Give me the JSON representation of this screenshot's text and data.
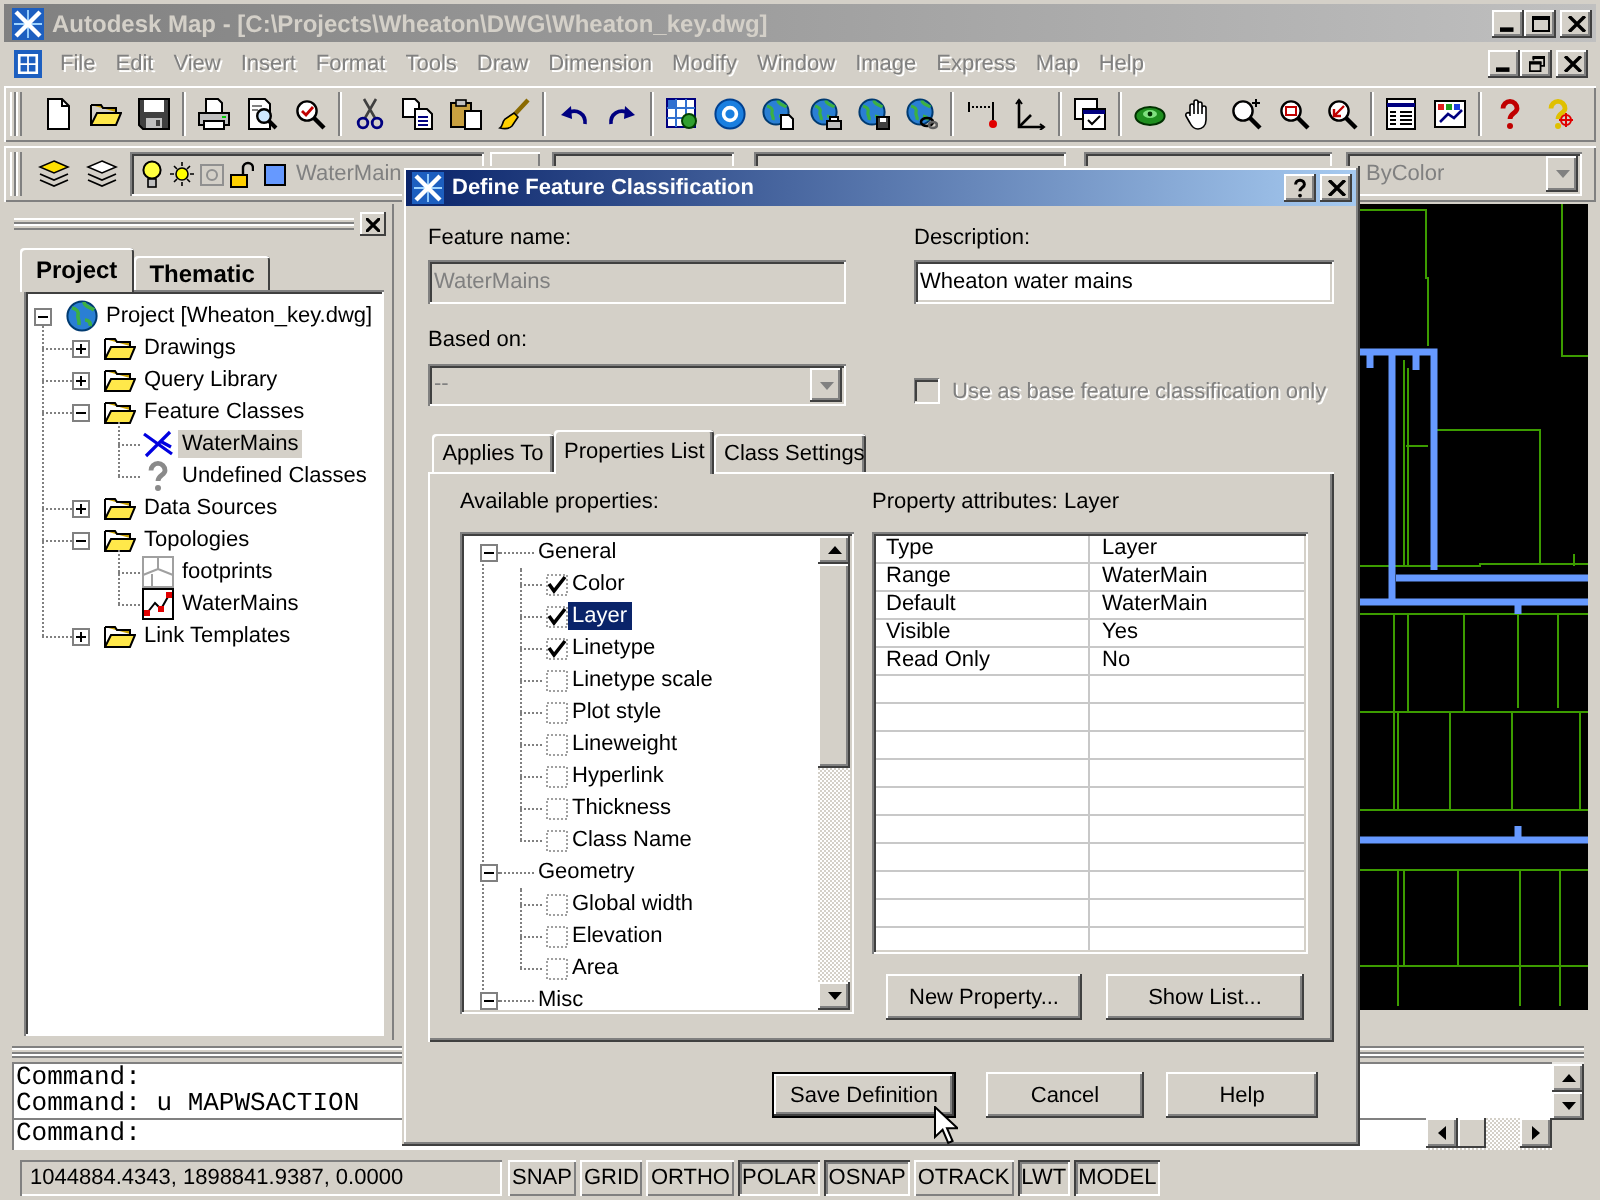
{
  "window": {
    "title": "Autodesk Map - [C:\\Projects\\Wheaton\\DWG\\Wheaton_key.dwg]",
    "active": false
  },
  "menu": [
    {
      "label": "File",
      "disabled": true
    },
    {
      "label": "Edit",
      "disabled": true
    },
    {
      "label": "View",
      "disabled": true
    },
    {
      "label": "Insert",
      "disabled": true
    },
    {
      "label": "Format",
      "disabled": true
    },
    {
      "label": "Tools",
      "disabled": true
    },
    {
      "label": "Draw",
      "disabled": true
    },
    {
      "label": "Dimension",
      "disabled": true
    },
    {
      "label": "Modify",
      "disabled": true
    },
    {
      "label": "Window",
      "disabled": true
    },
    {
      "label": "Image",
      "disabled": true
    },
    {
      "label": "Express",
      "disabled": true
    },
    {
      "label": "Map",
      "disabled": true
    },
    {
      "label": "Help",
      "disabled": true
    }
  ],
  "layer_toolbar": {
    "layer_dropdown": {
      "value": "WaterMain",
      "disabled": true
    },
    "right_dropdown": {
      "value": "ByColor",
      "disabled": true
    }
  },
  "panel": {
    "tabs": [
      {
        "label": "Project",
        "selected": true
      },
      {
        "label": "Thematic",
        "selected": false
      }
    ],
    "tree": [
      {
        "label": "Project [Wheaton_key.dwg]",
        "kind": "project",
        "expanded": true,
        "selected": false,
        "children": [
          {
            "label": "Drawings",
            "kind": "folder",
            "expanded": false,
            "selected": false
          },
          {
            "label": "Query Library",
            "kind": "folder",
            "expanded": false,
            "selected": false
          },
          {
            "label": "Feature Classes",
            "kind": "folder",
            "expanded": true,
            "selected": false,
            "children": [
              {
                "label": "WaterMains",
                "kind": "feature-class",
                "selected": true
              },
              {
                "label": "Undefined Classes",
                "kind": "undefined-class",
                "selected": false
              }
            ]
          },
          {
            "label": "Data Sources",
            "kind": "folder",
            "expanded": false,
            "selected": false
          },
          {
            "label": "Topologies",
            "kind": "folder",
            "expanded": true,
            "selected": false,
            "children": [
              {
                "label": "footprints",
                "kind": "polygon-topology",
                "selected": false
              },
              {
                "label": "WaterMains",
                "kind": "network-topology",
                "selected": false
              }
            ]
          },
          {
            "label": "Link Templates",
            "kind": "folder",
            "expanded": false,
            "selected": false
          }
        ]
      }
    ]
  },
  "dialog": {
    "title": "Define Feature Classification",
    "feature_name": {
      "label": "Feature name:",
      "value": "WaterMains",
      "disabled": true
    },
    "description": {
      "label": "Description:",
      "value": "Wheaton water mains"
    },
    "based_on": {
      "label": "Based on:",
      "value": "--",
      "disabled": true
    },
    "base_only": {
      "label": "Use as base feature classification only",
      "checked": false,
      "disabled": true
    },
    "tabs": [
      {
        "label": "Applies To",
        "selected": false
      },
      {
        "label": "Properties List",
        "selected": true
      },
      {
        "label": "Class Settings",
        "selected": false
      }
    ],
    "available_label": "Available properties:",
    "properties": [
      {
        "label": "General",
        "expanded": true,
        "selected": false,
        "children": [
          {
            "label": "Color",
            "checked": true,
            "selected": false
          },
          {
            "label": "Layer",
            "checked": true,
            "selected": true
          },
          {
            "label": "Linetype",
            "checked": true,
            "selected": false
          },
          {
            "label": "Linetype scale",
            "checked": false,
            "selected": false
          },
          {
            "label": "Plot style",
            "checked": false,
            "selected": false
          },
          {
            "label": "Lineweight",
            "checked": false,
            "selected": false
          },
          {
            "label": "Hyperlink",
            "checked": false,
            "selected": false
          },
          {
            "label": "Thickness",
            "checked": false,
            "selected": false
          },
          {
            "label": "Class Name",
            "checked": false,
            "selected": false
          }
        ]
      },
      {
        "label": "Geometry",
        "expanded": true,
        "selected": false,
        "children": [
          {
            "label": "Global width",
            "checked": false,
            "selected": false
          },
          {
            "label": "Elevation",
            "checked": false,
            "selected": false
          },
          {
            "label": "Area",
            "checked": false,
            "selected": false
          }
        ]
      },
      {
        "label": "Misc",
        "expanded": true,
        "selected": false
      }
    ],
    "attributes_label": "Property attributes: Layer",
    "attributes": [
      {
        "attribute": "Type",
        "value": "Layer"
      },
      {
        "attribute": "Range",
        "value": "WaterMain"
      },
      {
        "attribute": "Default",
        "value": "WaterMain"
      },
      {
        "attribute": "Visible",
        "value": "Yes"
      },
      {
        "attribute": "Read Only",
        "value": "No"
      }
    ],
    "panel_buttons": [
      {
        "label": "New Property..."
      },
      {
        "label": "Show List..."
      }
    ],
    "buttons": [
      {
        "label": "Save Definition",
        "default": true
      },
      {
        "label": "Cancel",
        "default": false
      },
      {
        "label": "Help",
        "default": false
      }
    ]
  },
  "command_line": {
    "history": [
      "Command:",
      "Command: u MAPWSACTION"
    ],
    "prompt": "Command:"
  },
  "status_bar": {
    "coordinates": "1044884.4343, 1898841.9387, 0.0000",
    "toggles": [
      {
        "label": "SNAP",
        "on": false
      },
      {
        "label": "GRID",
        "on": false
      },
      {
        "label": "ORTHO",
        "on": false
      },
      {
        "label": "POLAR",
        "on": true
      },
      {
        "label": "OSNAP",
        "on": true
      },
      {
        "label": "OTRACK",
        "on": false
      },
      {
        "label": "LWT",
        "on": true
      },
      {
        "label": "MODEL",
        "on": true
      }
    ]
  }
}
